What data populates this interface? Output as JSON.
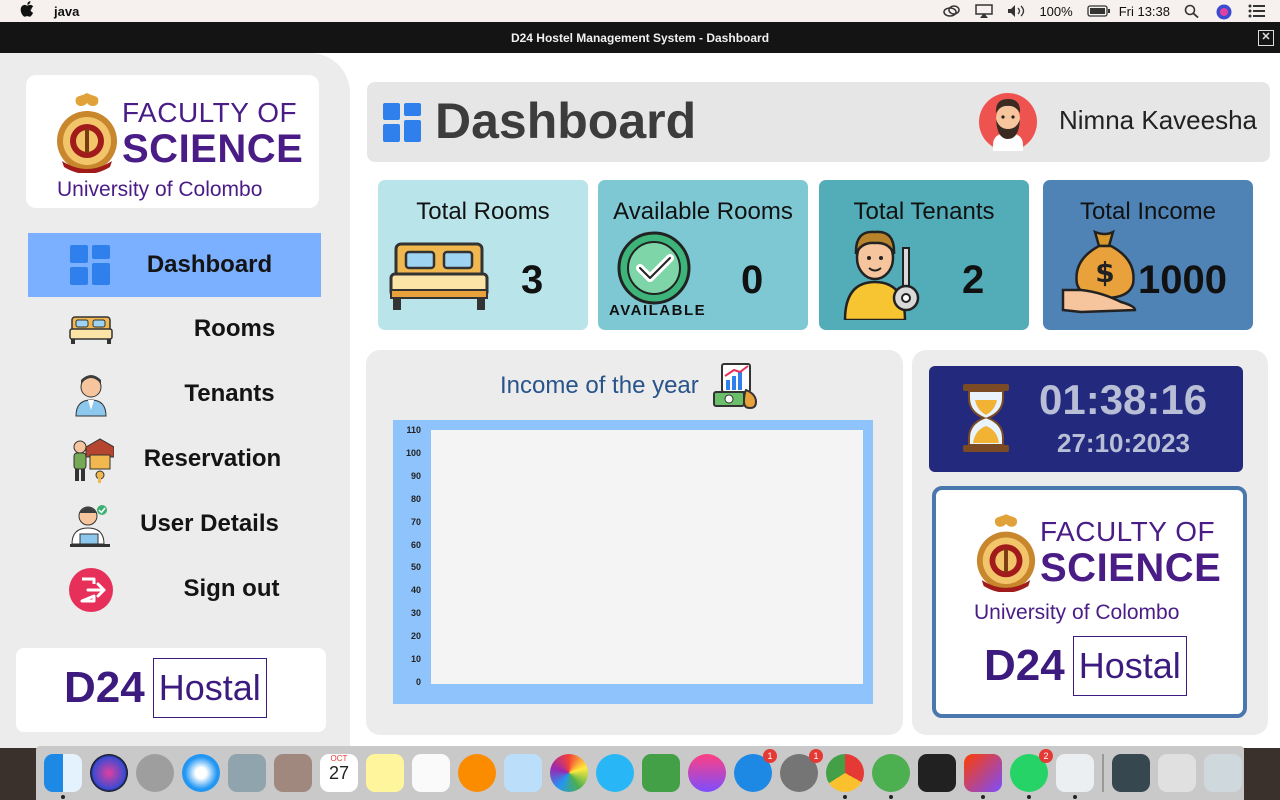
{
  "menubar": {
    "app_name": "java",
    "battery": "100%",
    "clock": "Fri 13:38"
  },
  "window": {
    "title": "D24 Hostel Management System - Dashboard",
    "close_glyph": "✕"
  },
  "logo": {
    "line1": "FACULTY OF",
    "line2": "SCIENCE",
    "line3": "University of Colombo"
  },
  "sidebar": {
    "items": [
      {
        "label": "Dashboard",
        "icon": "dashboard-icon",
        "active": true
      },
      {
        "label": "Rooms",
        "icon": "bed-icon"
      },
      {
        "label": "Tenants",
        "icon": "tenant-icon"
      },
      {
        "label": "Reservation",
        "icon": "reservation-icon"
      },
      {
        "label": "User Details",
        "icon": "user-details-icon"
      },
      {
        "label": "Sign out",
        "icon": "sign-out-icon"
      }
    ]
  },
  "brand": {
    "number": "D24",
    "word": "Hostal"
  },
  "header": {
    "title": "Dashboard",
    "user_name": "Nimna Kaveesha"
  },
  "stats": [
    {
      "label": "Total Rooms",
      "value": "3",
      "icon": "bed-icon",
      "color": "#b9e4ea"
    },
    {
      "label": "Available Rooms",
      "value": "0",
      "icon": "available-check-icon",
      "color": "#7ec8d3",
      "icon_text": "AVAILABLE"
    },
    {
      "label": "Total Tenants",
      "value": "2",
      "icon": "tenant-key-icon",
      "color": "#52adb8"
    },
    {
      "label": "Total Income",
      "value": "1000",
      "icon": "money-bag-icon",
      "color": "#4f83b5"
    }
  ],
  "income_panel": {
    "title": "Income of the year",
    "chart_data": {
      "type": "bar",
      "categories": [],
      "values": [],
      "ylim": [
        0,
        110
      ],
      "yticks": [
        "110",
        "100",
        "90",
        "80",
        "70",
        "60",
        "50",
        "40",
        "30",
        "20",
        "10",
        "0"
      ]
    }
  },
  "clock_panel": {
    "time": "01:38:16",
    "date": "27:10:2023"
  },
  "dock": {
    "calendar_month": "OCT",
    "calendar_day": "27",
    "badges": {
      "app_store": "1",
      "system_prefs": "1",
      "whatsapp": "2"
    }
  }
}
